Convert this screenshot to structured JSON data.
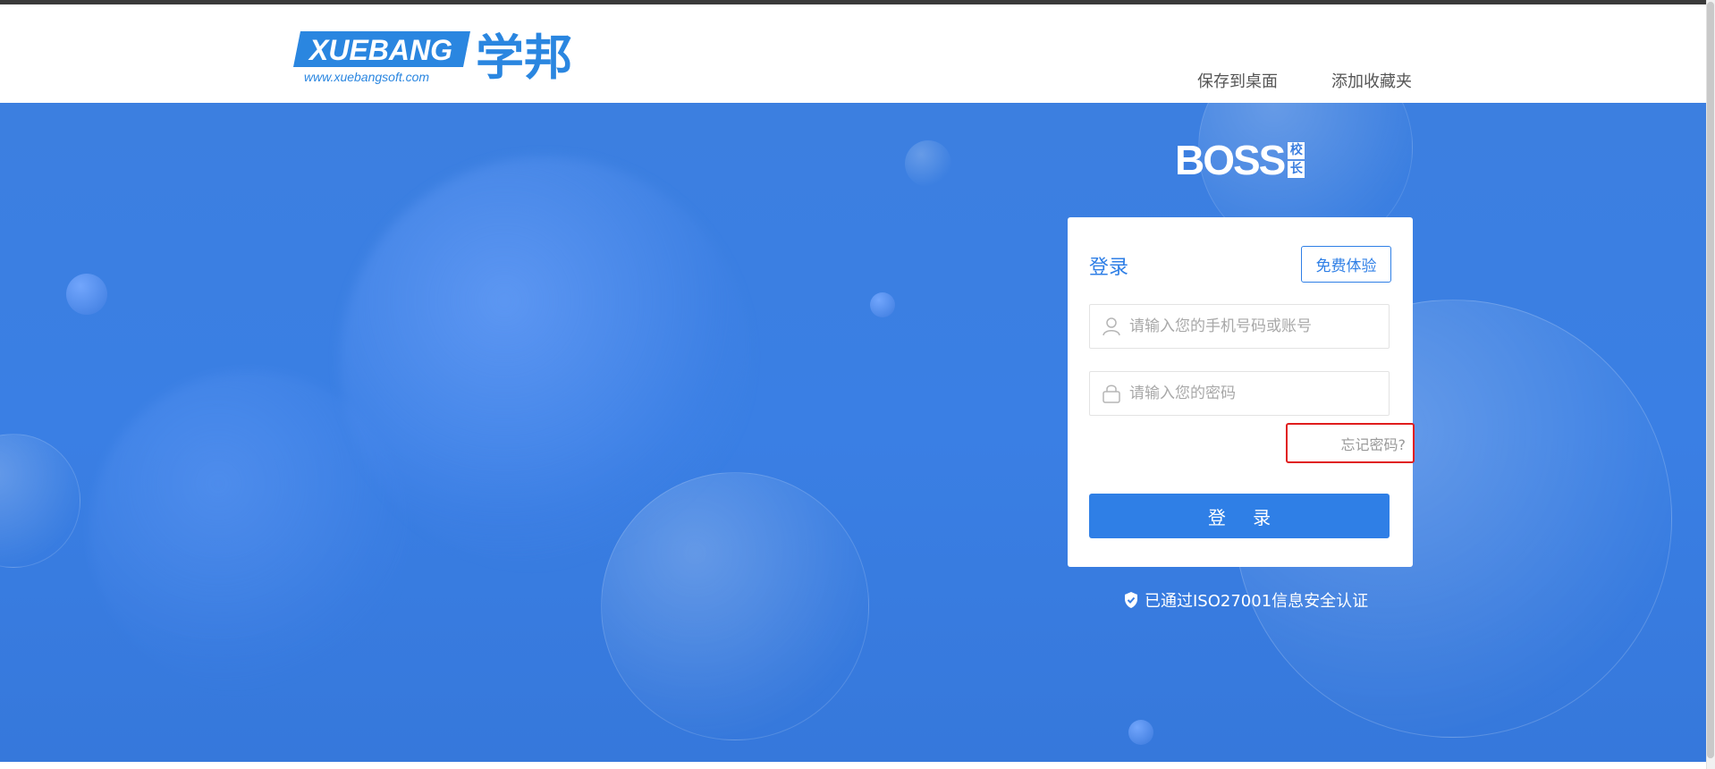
{
  "header": {
    "logo_text": "XUEBANG",
    "logo_cn": "学邦",
    "logo_url": "www.xuebangsoft.com",
    "links": [
      {
        "label": "保存到桌面"
      },
      {
        "label": "添加收藏夹"
      }
    ]
  },
  "brand": {
    "boss_text": "BOSS",
    "badge_top": "校",
    "badge_bottom": "长"
  },
  "login": {
    "title": "登录",
    "trial_label": "免费体验",
    "account_placeholder": "请输入您的手机号码或账号",
    "account_value": "",
    "password_placeholder": "请输入您的密码",
    "password_value": "",
    "forgot_label": "忘记密码?",
    "submit_label": "登 录"
  },
  "certification": {
    "text": "已通过ISO27001信息安全认证"
  },
  "colors": {
    "primary": "#2f7fe6",
    "hero_bg": "#3a7fe4",
    "highlight_border": "#e01d1d"
  },
  "icons": {
    "account": "user-icon",
    "password": "lock-icon",
    "certification": "shield-check-icon"
  }
}
